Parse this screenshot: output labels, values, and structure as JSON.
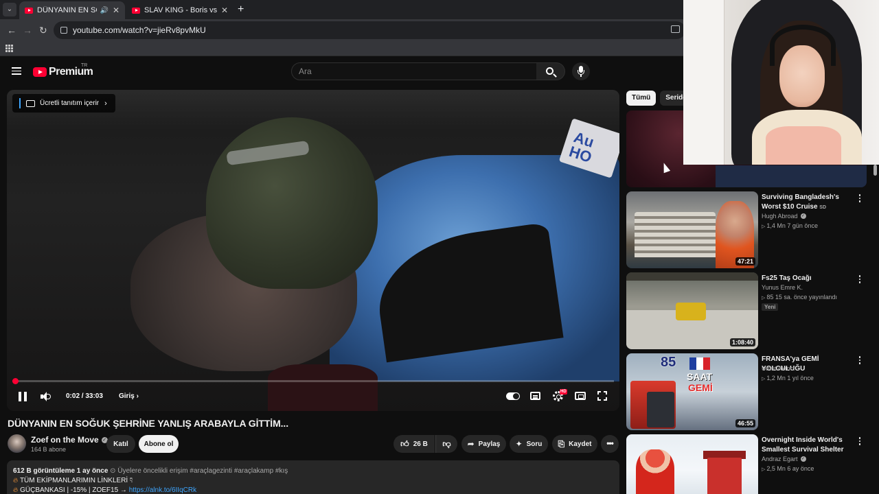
{
  "browser": {
    "tabs": [
      {
        "title": "DÜNYANIN EN SOĞUK ŞEHRİNE",
        "active": true
      },
      {
        "title": "SLAV KING - Boris vs. DJ Blyatman",
        "active": false
      }
    ],
    "url": "youtube.com/watch?v=jieRv8pvMkU"
  },
  "masthead": {
    "logo_text": "Premium",
    "country_code": "TR",
    "search_placeholder": "Ara"
  },
  "player": {
    "sponsor_label": "Ücretli tanıtım içerir",
    "time_display": "0:02 / 33:03",
    "chapter_label": "Giriş",
    "progress_fraction": 0.001,
    "hd_badge": "HD"
  },
  "video": {
    "title": "DÜNYANIN EN SOĞUK ŞEHRİNE YANLIŞ ARABAYLA GİTTİM...",
    "channel_name": "Zoef on the Move",
    "subscribers": "164 B abone",
    "join_label": "Katıl",
    "subscribe_label": "Abone ol",
    "likes": "26 B",
    "share_label": "Paylaş",
    "ask_label": "Soru",
    "save_label": "Kaydet"
  },
  "description": {
    "views_date": "612 B görüntüleme  1 ay önce",
    "members": "Üyelere öncelikli erişim",
    "hashtags": "#araçlagezinti #araçlakamp #kış",
    "line1": "TÜM EKİPMANLARIMIN LİNKLERİ",
    "line2_prefix": "GÜÇBANKASI | -15% | ZOEF15 →",
    "line2_link": "https://alnk.to/6IIqCRk"
  },
  "sidebar": {
    "chips": [
      "Tümü",
      "Seriden"
    ],
    "recommendations": [
      {
        "title": "Surviving Bangladesh's Worst $10 Cruise",
        "quality": "SD",
        "channel": "Hugh Abroad",
        "verified": true,
        "meta": "1,4 Mn  7 gün önce",
        "duration": "47:21",
        "new": false
      },
      {
        "title": "Fs25 Taş Ocağı",
        "quality": "",
        "channel": "Yunus Emre K.",
        "verified": false,
        "meta": "85  15 sa. önce yayınlandı",
        "duration": "1:08:40",
        "new": true,
        "new_label": "Yeni"
      },
      {
        "title": "FRANSA'ya GEMİ YOLCULUĞU",
        "quality": "",
        "channel": "Umut Akıncı",
        "verified": false,
        "meta": "1,2 Mn  1 yıl önce",
        "duration": "46:55",
        "new": false,
        "thumb_text": {
          "num": "85",
          "saat": "SAAT",
          "gemi": "GEMİ"
        }
      },
      {
        "title": "Overnight Inside World's Smallest Survival Shelter",
        "quality": "",
        "channel": "Andraz Egart",
        "verified": true,
        "meta": "2,5 Mn  6 ay önce",
        "duration": "",
        "new": false
      }
    ]
  },
  "colors": {
    "accent_red": "#ff0033",
    "link_blue": "#3ea6ff",
    "background": "#0f0f0f"
  }
}
